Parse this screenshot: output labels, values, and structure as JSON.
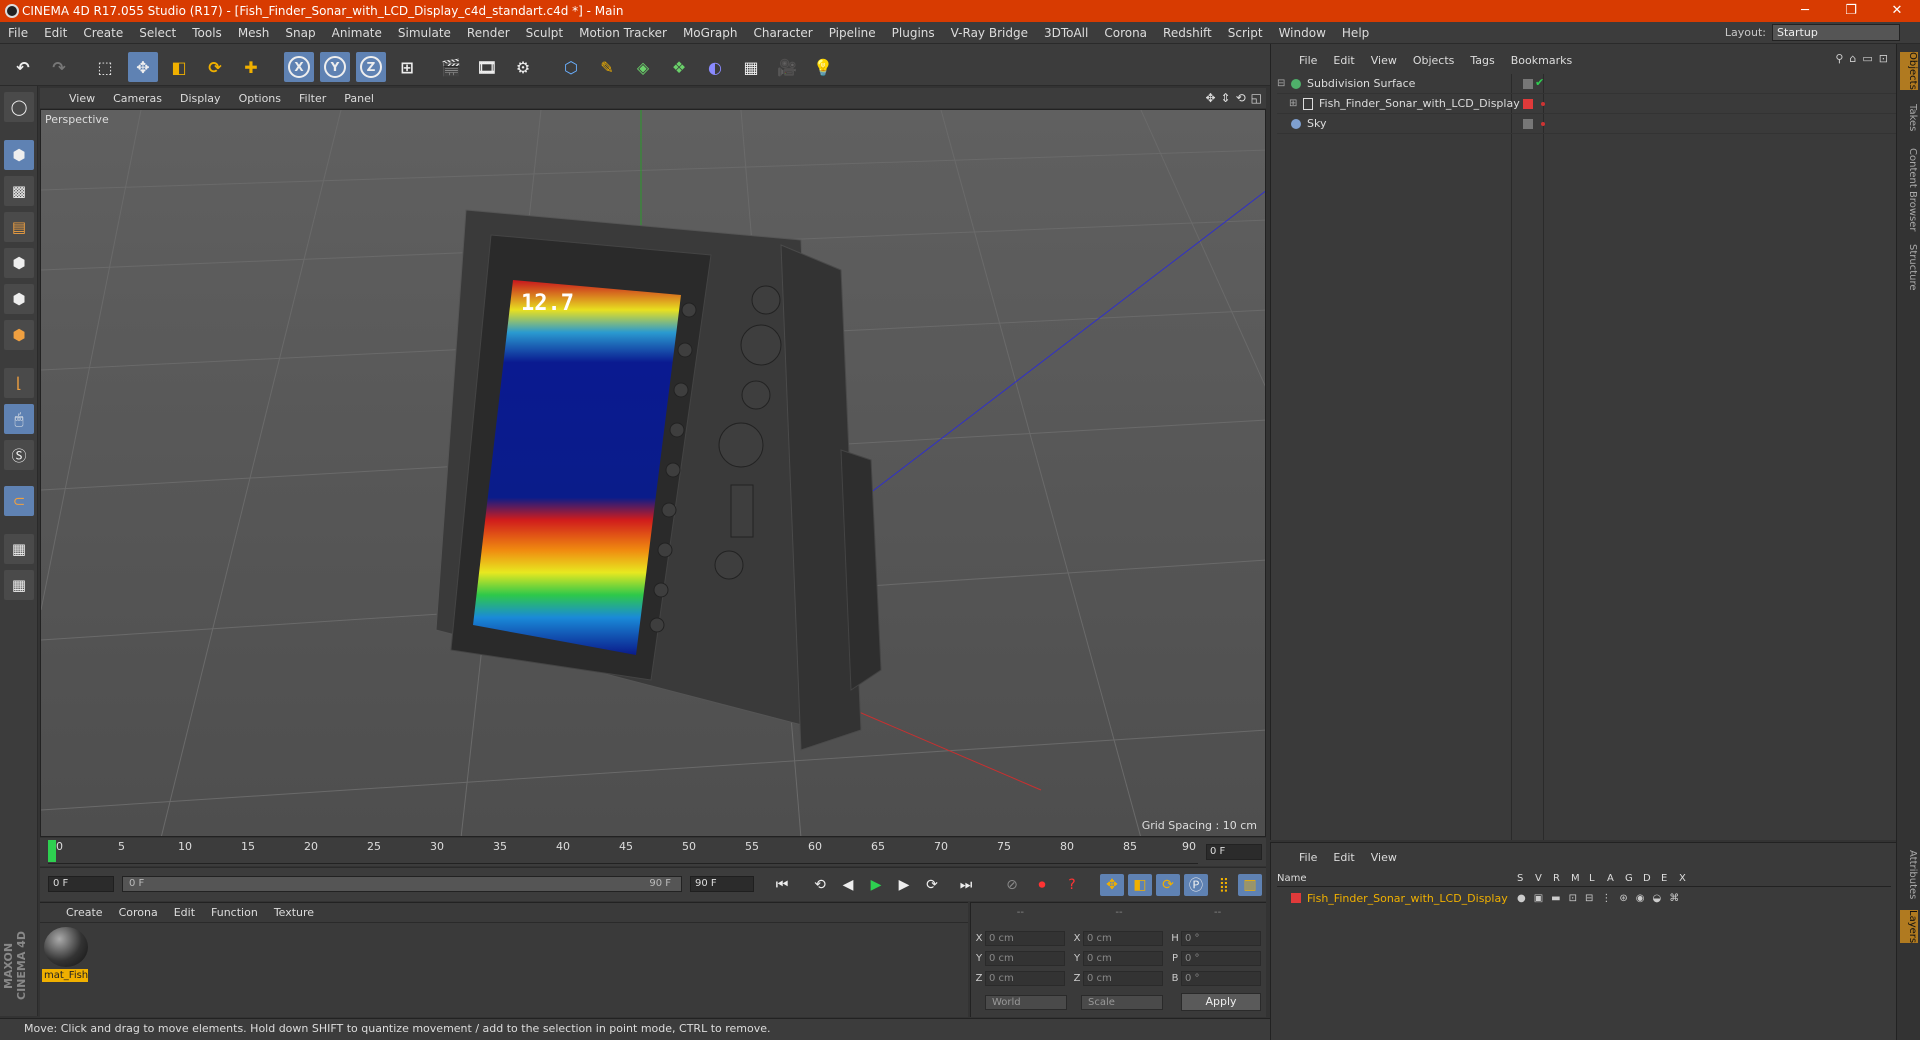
{
  "window": {
    "title": "CINEMA 4D R17.055 Studio (R17) - [Fish_Finder_Sonar_with_LCD_Display_c4d_standart.c4d *] - Main",
    "minimize": "─",
    "maximize": "❐",
    "close": "✕"
  },
  "menu": [
    "File",
    "Edit",
    "Create",
    "Select",
    "Tools",
    "Mesh",
    "Snap",
    "Animate",
    "Simulate",
    "Render",
    "Sculpt",
    "Motion Tracker",
    "MoGraph",
    "Character",
    "Pipeline",
    "Plugins",
    "V-Ray Bridge",
    "3DToAll",
    "Corona",
    "Redshift",
    "Script",
    "Window",
    "Help"
  ],
  "layout": {
    "label": "Layout:",
    "value": "Startup"
  },
  "toolbar": {
    "x": "X",
    "y": "Y",
    "z": "Z"
  },
  "viewport": {
    "menu": [
      "View",
      "Cameras",
      "Display",
      "Options",
      "Filter",
      "Panel"
    ],
    "label": "Perspective",
    "grid_spacing": "Grid Spacing : 10 cm",
    "readout": "12.7"
  },
  "timeline": {
    "ticks": [
      "0",
      "5",
      "10",
      "15",
      "20",
      "25",
      "30",
      "35",
      "40",
      "45",
      "50",
      "55",
      "60",
      "65",
      "70",
      "75",
      "80",
      "85",
      "90"
    ],
    "current": "0 F"
  },
  "playbar": {
    "start": "0 F",
    "range_start": "0 F",
    "range_end": "90 F",
    "end": "90 F"
  },
  "materials": {
    "menu": [
      "Create",
      "Corona",
      "Edit",
      "Function",
      "Texture"
    ],
    "items": [
      {
        "name": "mat_Fish"
      }
    ]
  },
  "coords": {
    "headers": [
      "--",
      "--",
      "--"
    ],
    "rows": [
      {
        "l1": "X",
        "v1": "0 cm",
        "l2": "X",
        "v2": "0 cm",
        "l3": "H",
        "v3": "0 °"
      },
      {
        "l1": "Y",
        "v1": "0 cm",
        "l2": "Y",
        "v2": "0 cm",
        "l3": "P",
        "v3": "0 °"
      },
      {
        "l1": "Z",
        "v1": "0 cm",
        "l2": "Z",
        "v2": "0 cm",
        "l3": "B",
        "v3": "0 °"
      }
    ],
    "mode": "World",
    "scale": "Scale",
    "apply": "Apply"
  },
  "objects": {
    "menu": [
      "File",
      "Edit",
      "View",
      "Objects",
      "Tags",
      "Bookmarks"
    ],
    "items": [
      {
        "name": "Subdivision Surface",
        "color": "#4fb06a"
      },
      {
        "name": "Fish_Finder_Sonar_with_LCD_Display",
        "color": "#e03a3a"
      },
      {
        "name": "Sky",
        "color": "#7fa0d0"
      }
    ]
  },
  "attributes": {
    "menu": [
      "File",
      "Edit",
      "View"
    ],
    "headers": [
      "Name",
      "S",
      "V",
      "R",
      "M",
      "L",
      "A",
      "G",
      "D",
      "E",
      "X"
    ],
    "row": "Fish_Finder_Sonar_with_LCD_Display"
  },
  "side_tabs": [
    "Objects",
    "Takes",
    "Content Browser",
    "Structure"
  ],
  "side_tabs_bottom": [
    "Attributes",
    "Layers"
  ],
  "status": "Move: Click and drag to move elements. Hold down SHIFT to quantize movement / add to the selection in point mode, CTRL to remove.",
  "logo": "MAXON CINEMA 4D"
}
